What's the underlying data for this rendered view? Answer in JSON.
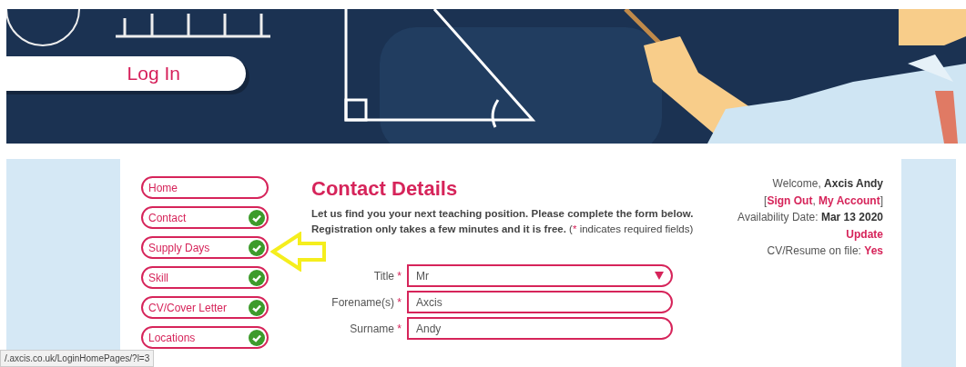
{
  "banner": {
    "kind": "picture",
    "login_button": "Log In"
  },
  "sidebar": {
    "items": [
      {
        "label": "Home",
        "completed": false
      },
      {
        "label": "Contact",
        "completed": true
      },
      {
        "label": "Supply Days",
        "completed": true
      },
      {
        "label": "Skill",
        "completed": true
      },
      {
        "label": "CV/Cover Letter",
        "completed": true
      },
      {
        "label": "Locations",
        "completed": true
      }
    ]
  },
  "form": {
    "title": "Contact Details",
    "intro": "Let us find you your next teaching position. Please complete the form below. Registration only takes a few minutes and it is free.",
    "note_open": "(",
    "note_mark": "*",
    "note_text": " indicates required fields)",
    "fields": [
      {
        "label": "Title",
        "required": true,
        "kind": "select",
        "value": "Mr"
      },
      {
        "label": "Forename(s)",
        "required": true,
        "kind": "text",
        "value": "Axcis"
      },
      {
        "label": "Surname",
        "required": true,
        "kind": "text",
        "value": "Andy"
      }
    ]
  },
  "account": {
    "welcome_label": "Welcome, ",
    "user_name": "Axcis Andy",
    "bracket_open": "[",
    "sign_out": "Sign Out",
    "separator": ", ",
    "my_account": "My Account",
    "bracket_close": "]",
    "availability_label": "Availability Date: ",
    "availability_date": "Mar 13 2020",
    "update_link": "Update",
    "cv_label": "CV/Resume on file: ",
    "cv_value": "Yes"
  },
  "status_bar": "/.axcis.co.uk/LoginHomePages/?l=3"
}
